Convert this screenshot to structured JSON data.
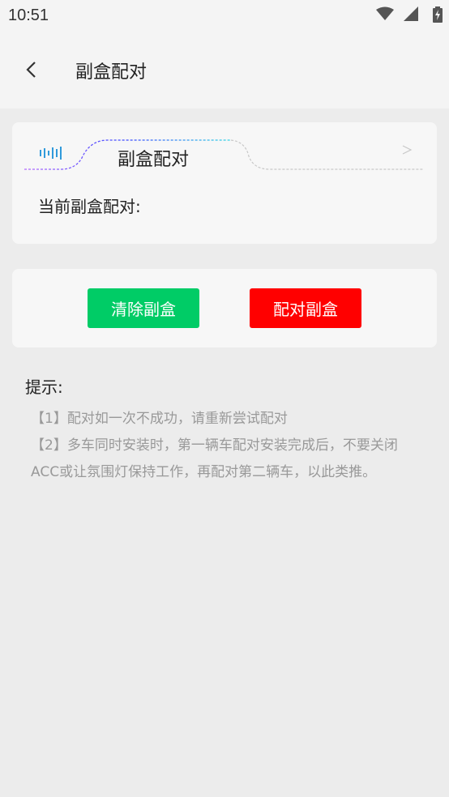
{
  "status_bar": {
    "time": "10:51",
    "icons": [
      "wifi-icon",
      "signal-icon",
      "battery-charging-icon"
    ]
  },
  "app_bar": {
    "title": "副盒配对",
    "back_icon": "chevron-left-icon"
  },
  "pair_card": {
    "title": "副盒配对",
    "status_label": "当前副盒配对:"
  },
  "actions": {
    "clear_label": "清除副盒",
    "pair_label": "配对副盒",
    "clear_color": "#00cc66",
    "pair_color": "#ff0000"
  },
  "tips": {
    "title": "提示:",
    "items": [
      "【1】配对如一次不成功，请重新尝试配对",
      "【2】多车同时安装时，第一辆车配对安装完成后，不要关闭ACC或让氛围灯保持工作，再配对第二辆车，以此类推。"
    ]
  }
}
